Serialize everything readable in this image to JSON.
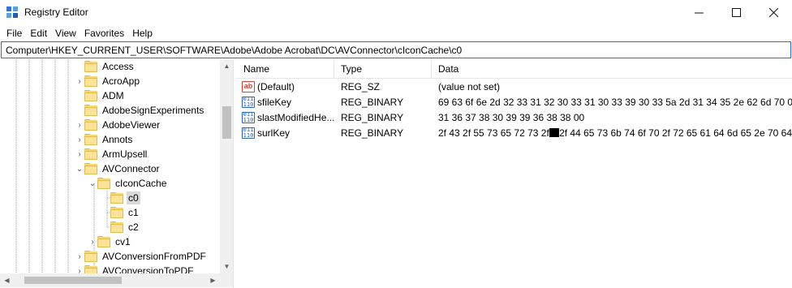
{
  "window": {
    "title": "Registry Editor",
    "app_icon": "regedit-icon",
    "controls": {
      "minimize": "—",
      "maximize": "☐",
      "close": "✕"
    }
  },
  "menu": [
    "File",
    "Edit",
    "View",
    "Favorites",
    "Help"
  ],
  "address": "Computer\\HKEY_CURRENT_USER\\SOFTWARE\\Adobe\\Adobe Acrobat\\DC\\AVConnector\\cIconCache\\c0",
  "tree": {
    "items": [
      {
        "label": "Access",
        "chevron": "",
        "selected": false
      },
      {
        "label": "AcroApp",
        "chevron": "›",
        "selected": false
      },
      {
        "label": "ADM",
        "chevron": "",
        "selected": false
      },
      {
        "label": "AdobeSignExperiments",
        "chevron": "",
        "selected": false
      },
      {
        "label": "AdobeViewer",
        "chevron": "›",
        "selected": false
      },
      {
        "label": "Annots",
        "chevron": "›",
        "selected": false
      },
      {
        "label": "ArmUpsell",
        "chevron": "›",
        "selected": false
      },
      {
        "label": "AVConnector",
        "chevron": "⌄",
        "selected": false
      },
      {
        "label": "cIconCache",
        "chevron": "⌄",
        "selected": false
      },
      {
        "label": "c0",
        "chevron": "",
        "selected": true
      },
      {
        "label": "c1",
        "chevron": "",
        "selected": false
      },
      {
        "label": "c2",
        "chevron": "",
        "selected": false
      },
      {
        "label": "cv1",
        "chevron": "›",
        "selected": false
      },
      {
        "label": "AVConversionFromPDF",
        "chevron": "›",
        "selected": false
      },
      {
        "label": "AVConversionToPDF",
        "chevron": "›",
        "selected": false
      }
    ]
  },
  "list": {
    "columns": {
      "name": "Name",
      "type": "Type",
      "data": "Data"
    },
    "rows": [
      {
        "icon": "string-value-icon",
        "icon_text": "ab",
        "name": "(Default)",
        "type": "REG_SZ",
        "data": "(value not set)",
        "data_suffix": ""
      },
      {
        "icon": "binary-value-icon",
        "icon_text": "011|110",
        "name": "sfileKey",
        "type": "REG_BINARY",
        "data": "69 63 6f 6e 2d 32 33 31 32 30 33 31 30 33 39 30 33 5a 2d 31 34 35 2e 62 6d 70 00",
        "data_suffix": ""
      },
      {
        "icon": "binary-value-icon",
        "icon_text": "011|110",
        "name": "slastModifiedHe...",
        "type": "REG_BINARY",
        "data": "31 36 37 38 30 39 39 36 38 38 00",
        "data_suffix": ""
      },
      {
        "icon": "binary-value-icon",
        "icon_text": "011|110",
        "name": "surlKey",
        "type": "REG_BINARY",
        "data": "2f 43 2f 55 73 65 72 73 2f",
        "data_suffix": "2f 44 65 73 6b 74 6f 70 2f 72 65 61 64 6d 65 2e 70 64"
      }
    ]
  },
  "colors": {
    "address_border": "#2a6fd6",
    "folder": "#f4d778",
    "selection": "#d9d9d9"
  }
}
